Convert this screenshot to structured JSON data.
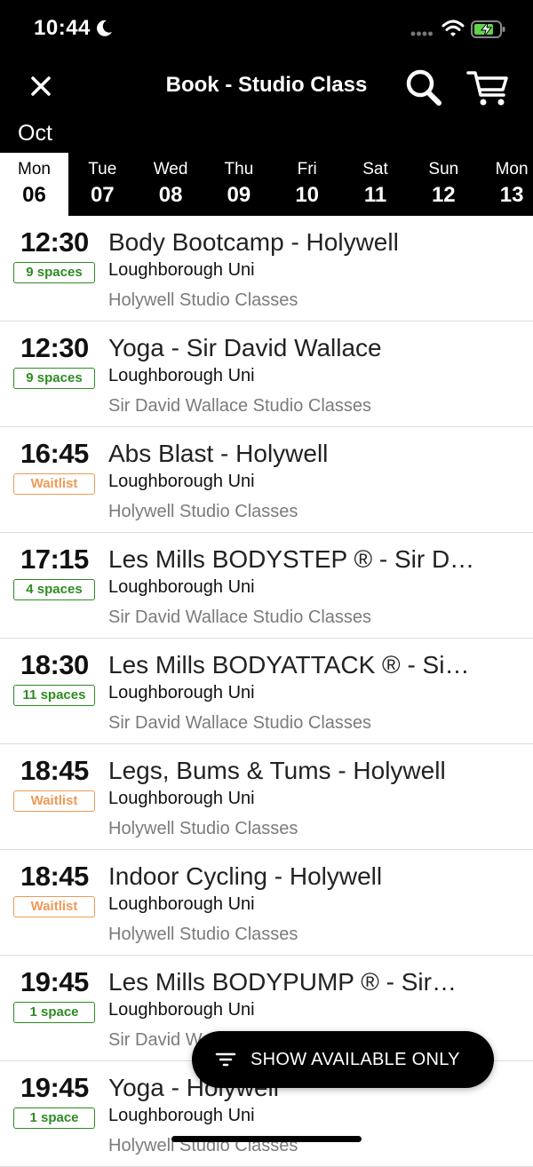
{
  "status_bar": {
    "time": "10:44"
  },
  "header": {
    "title": "Book - Studio Class",
    "icons": [
      "close-icon",
      "search-icon",
      "cart-icon"
    ]
  },
  "calendar": {
    "month": "Oct",
    "days": [
      {
        "name": "Mon",
        "num": "06",
        "selected": true
      },
      {
        "name": "Tue",
        "num": "07"
      },
      {
        "name": "Wed",
        "num": "08"
      },
      {
        "name": "Thu",
        "num": "09"
      },
      {
        "name": "Fri",
        "num": "10"
      },
      {
        "name": "Sat",
        "num": "11"
      },
      {
        "name": "Sun",
        "num": "12"
      },
      {
        "name": "Mon",
        "num": "13"
      }
    ]
  },
  "classes": [
    {
      "time": "12:30",
      "badge": "9 spaces",
      "status": "available",
      "name": "Body Bootcamp - Holywell",
      "location": "Loughborough Uni",
      "category": "Holywell Studio Classes"
    },
    {
      "time": "12:30",
      "badge": "9 spaces",
      "status": "available",
      "name": "Yoga - Sir David Wallace",
      "location": "Loughborough Uni",
      "category": "Sir David Wallace Studio Classes"
    },
    {
      "time": "16:45",
      "badge": "Waitlist",
      "status": "waitlist",
      "name": "Abs Blast - Holywell",
      "location": "Loughborough Uni",
      "category": "Holywell Studio Classes"
    },
    {
      "time": "17:15",
      "badge": "4 spaces",
      "status": "available",
      "name": "Les Mills BODYSTEP ® - Sir D…",
      "location": "Loughborough Uni",
      "category": "Sir David Wallace Studio Classes"
    },
    {
      "time": "18:30",
      "badge": "11 spaces",
      "status": "available",
      "name": "Les Mills BODYATTACK ® - Si…",
      "location": "Loughborough Uni",
      "category": "Sir David Wallace Studio Classes"
    },
    {
      "time": "18:45",
      "badge": "Waitlist",
      "status": "waitlist",
      "name": "Legs, Bums & Tums - Holywell",
      "location": "Loughborough Uni",
      "category": "Holywell Studio Classes"
    },
    {
      "time": "18:45",
      "badge": "Waitlist",
      "status": "waitlist",
      "name": "Indoor Cycling - Holywell",
      "location": "Loughborough Uni",
      "category": "Holywell Studio Classes"
    },
    {
      "time": "19:45",
      "badge": "1 space",
      "status": "available",
      "name": "Les Mills BODYPUMP ® - Sir…",
      "location": "Loughborough Uni",
      "category": "Sir David Wallace Studio Classes"
    },
    {
      "time": "19:45",
      "badge": "1 space",
      "status": "available",
      "name": "Yoga - Holywell",
      "location": "Loughborough Uni",
      "category": "Holywell Studio Classes"
    }
  ],
  "filter_button": {
    "label": "SHOW AVAILABLE ONLY",
    "icon": "filter-icon"
  },
  "colors": {
    "available": "#2e8b22",
    "waitlist": "#ee9a56",
    "header_bg": "#000000",
    "muted_text": "#7b7b7b"
  }
}
